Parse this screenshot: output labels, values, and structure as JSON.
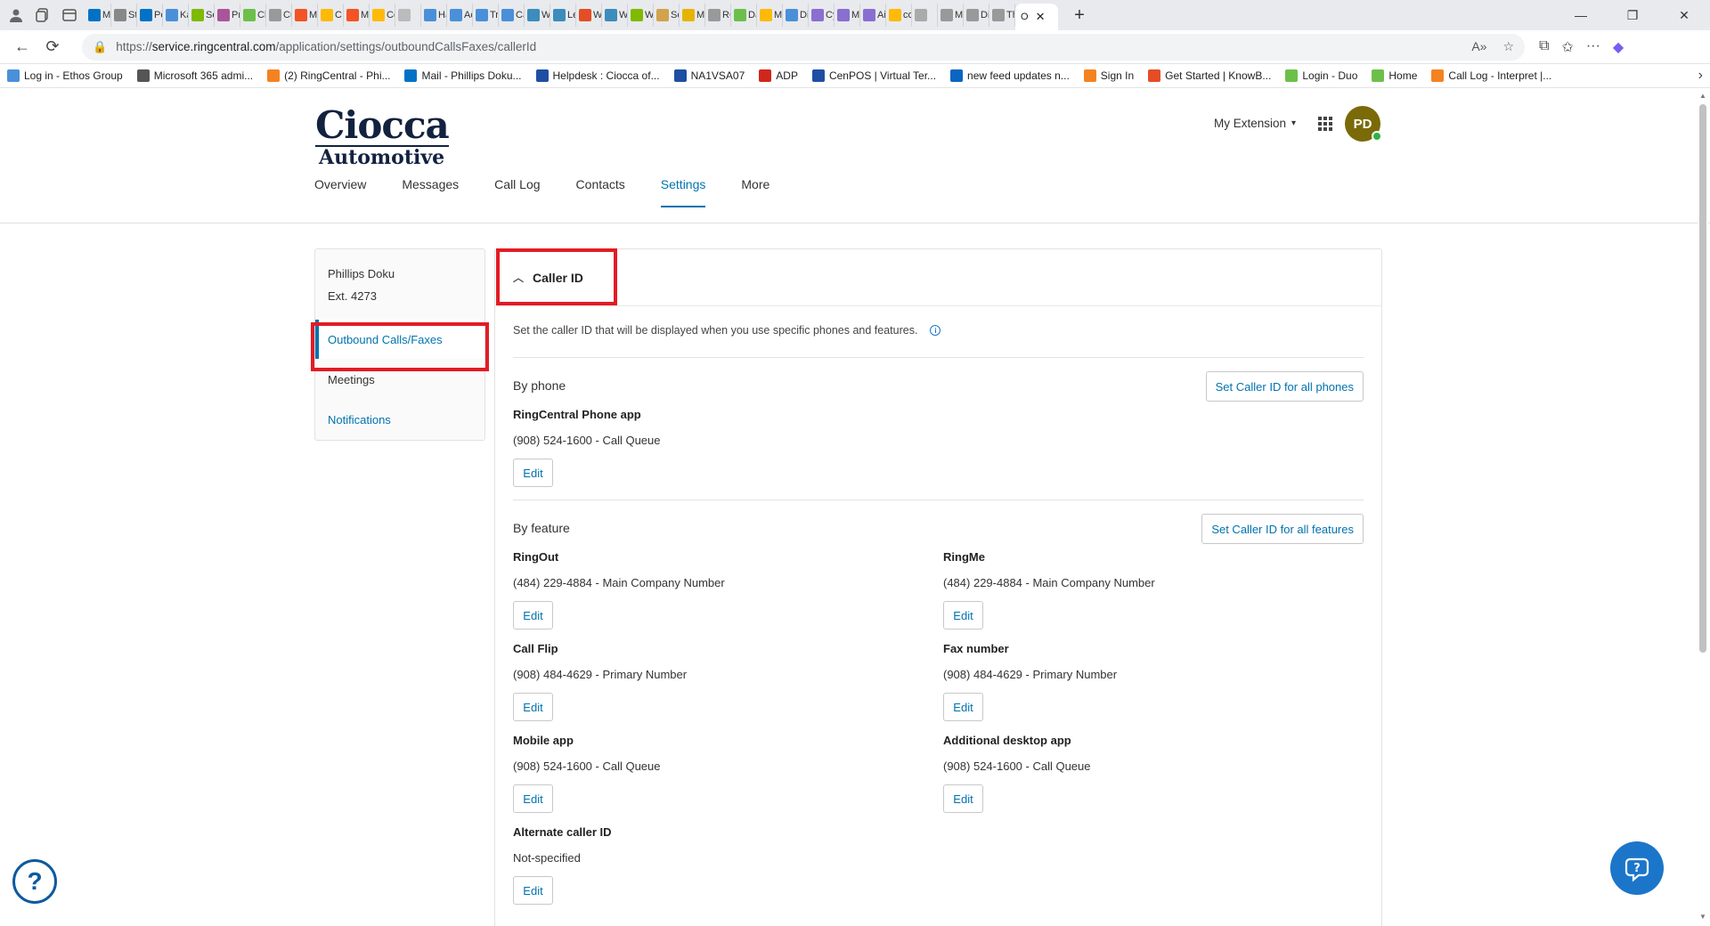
{
  "browser": {
    "tabs_mini": [
      "M",
      "St",
      "Pe",
      "Ka",
      "Se",
      "Pr",
      "Cl",
      "Cu",
      "M",
      "C",
      "M",
      "Co",
      "",
      "Ha",
      "Ac",
      "Tr",
      "Ca",
      "W",
      "Le",
      "W",
      "W",
      "W",
      "Se",
      "M",
      "RC",
      "Da",
      "M",
      "Di",
      "Cy",
      "M",
      "Ai",
      "co",
      "",
      "M",
      "Di",
      "Th"
    ],
    "active_tab_label": "O",
    "url_prefix": "https://",
    "url_host": "service.ringcentral.com",
    "url_path": "/application/settings/outboundCallsFaxes/callerId",
    "bookmarks": [
      {
        "label": "Log in - Ethos Group",
        "color": "#4a90d9"
      },
      {
        "label": "Microsoft 365 admi...",
        "color": "#555555"
      },
      {
        "label": "(2) RingCentral - Phi...",
        "color": "#f58220"
      },
      {
        "label": "Mail - Phillips Doku...",
        "color": "#0072c6"
      },
      {
        "label": "Helpdesk : Ciocca of...",
        "color": "#1e4fa3"
      },
      {
        "label": "NA1VSA07",
        "color": "#1e4fa3"
      },
      {
        "label": "ADP",
        "color": "#d0271d"
      },
      {
        "label": "CenPOS | Virtual Ter...",
        "color": "#1e4fa3"
      },
      {
        "label": "new feed updates n...",
        "color": "#0a66c2"
      },
      {
        "label": "Sign In",
        "color": "#f58220"
      },
      {
        "label": "Get Started | KnowB...",
        "color": "#e44d26"
      },
      {
        "label": "Login - Duo",
        "color": "#6cc04a"
      },
      {
        "label": "Home",
        "color": "#6cc04a"
      },
      {
        "label": "Call Log - Interpret |...",
        "color": "#f58220"
      }
    ]
  },
  "header": {
    "logo_line1": "Ciocca",
    "logo_line2": "Automotive",
    "ext_menu_label": "My Extension",
    "avatar_initials": "PD",
    "nav": [
      "Overview",
      "Messages",
      "Call Log",
      "Contacts",
      "Settings",
      "More"
    ]
  },
  "sidebar": {
    "user_name": "Phillips Doku",
    "user_ext": "Ext. 4273",
    "items": [
      "Outbound Calls/Faxes",
      "Meetings",
      "Notifications"
    ]
  },
  "caller_id": {
    "title": "Caller ID",
    "description": "Set the caller ID that will be displayed when you use specific phones and features.",
    "by_phone_label": "By phone",
    "by_phone_button": "Set Caller ID for all phones",
    "phone_app_title": "RingCentral Phone app",
    "phone_app_value": "(908) 524-1600 - Call Queue",
    "by_feature_label": "By feature",
    "by_feature_button": "Set Caller ID for all features",
    "edit_label": "Edit",
    "features": [
      {
        "title": "RingOut",
        "value": "(484) 229-4884 - Main Company Number"
      },
      {
        "title": "RingMe",
        "value": "(484) 229-4884 - Main Company Number"
      },
      {
        "title": "Call Flip",
        "value": "(908) 484-4629 - Primary Number"
      },
      {
        "title": "Fax number",
        "value": "(908) 484-4629 - Primary Number"
      },
      {
        "title": "Mobile app",
        "value": "(908) 524-1600 - Call Queue"
      },
      {
        "title": "Additional desktop app",
        "value": "(908) 524-1600 - Call Queue"
      },
      {
        "title": "Alternate caller ID",
        "value": "Not-specified"
      }
    ]
  },
  "colors": {
    "accent": "#0073ae",
    "highlight": "#e31b23",
    "avatar": "#7a6a08"
  },
  "icons": [
    "profile-icon",
    "workspaces-icon",
    "tab-actions-icon",
    "back-icon",
    "reload-icon",
    "lock-icon",
    "read-aloud-icon",
    "favorite-star-icon",
    "extensions-icon",
    "favorites-icon",
    "more-icon",
    "copilot-icon",
    "apps-grid-icon",
    "chevron-down-icon",
    "chevron-up-icon",
    "info-icon",
    "help-icon",
    "support-chat-icon"
  ]
}
